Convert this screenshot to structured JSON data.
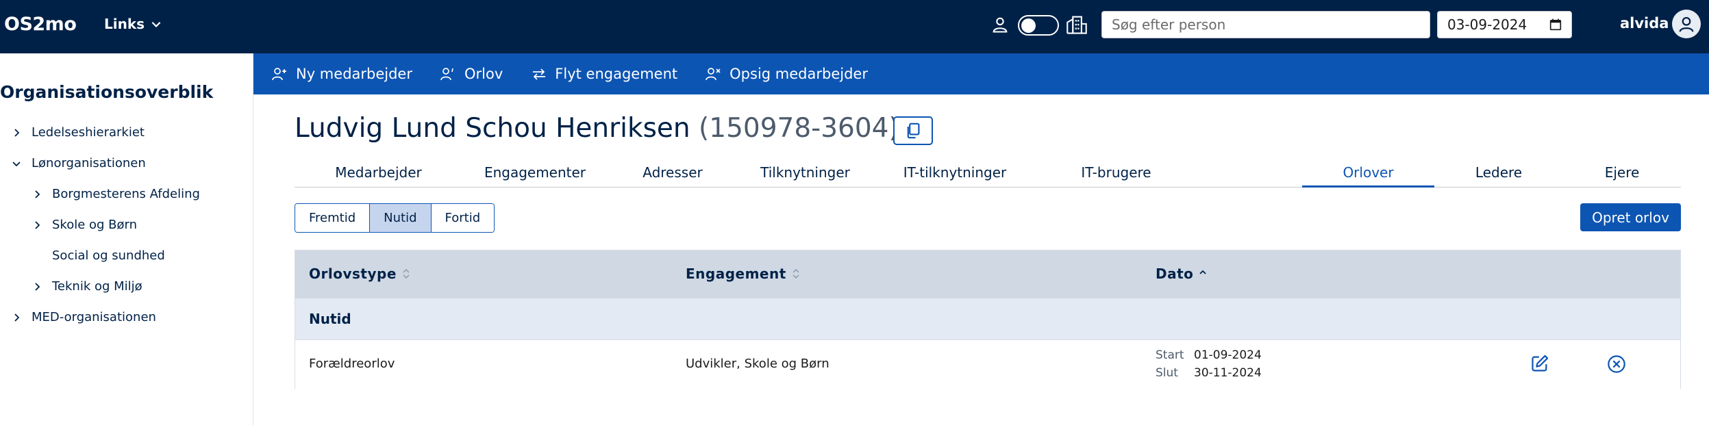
{
  "app": {
    "name": "OS2mo"
  },
  "topbar": {
    "links_label": "Links",
    "search_placeholder": "Søg efter person",
    "date_value": "03-09-2024",
    "username": "alvida"
  },
  "sidebar": {
    "title": "Organisationsoverblik",
    "items": [
      {
        "label": "Ledelseshierarkiet",
        "expanded": false
      },
      {
        "label": "Lønorganisationen",
        "expanded": true
      },
      {
        "label": "Borgmesterens Afdeling",
        "expanded": false
      },
      {
        "label": "Skole og Børn",
        "expanded": false
      },
      {
        "label": "Social og sundhed",
        "expanded": false
      },
      {
        "label": "Teknik og Miljø",
        "expanded": false
      },
      {
        "label": "MED-organisationen",
        "expanded": false
      }
    ]
  },
  "actions": [
    {
      "label": "Ny medarbejder",
      "icon": "user-plus-icon"
    },
    {
      "label": "Orlov",
      "icon": "user-leave-icon"
    },
    {
      "label": "Flyt engagement",
      "icon": "swap-arrows-icon"
    },
    {
      "label": "Opsig medarbejder",
      "icon": "user-remove-icon"
    }
  ],
  "employee": {
    "name": "Ludvig Lund Schou Henriksen",
    "cpr": "(150978-3604)"
  },
  "tabs": [
    {
      "label": "Medarbejder",
      "active": false
    },
    {
      "label": "Engagementer",
      "active": false
    },
    {
      "label": "Adresser",
      "active": false
    },
    {
      "label": "Tilknytninger",
      "active": false
    },
    {
      "label": "IT-tilknytninger",
      "active": false
    },
    {
      "label": "IT-brugere",
      "active": false
    },
    {
      "label": "Orlover",
      "active": true
    },
    {
      "label": "Ledere",
      "active": false
    },
    {
      "label": "Ejere",
      "active": false
    }
  ],
  "time_filter": {
    "options": [
      "Fremtid",
      "Nutid",
      "Fortid"
    ],
    "selected": "Nutid"
  },
  "create_button": "Opret orlov",
  "table": {
    "columns": [
      "Orlovstype",
      "Engagement",
      "Dato"
    ],
    "group_label": "Nutid",
    "rows": [
      {
        "orlovstype": "Forældreorlov",
        "engagement": "Udvikler, Skole og Børn",
        "start_label": "Start",
        "start": "01-09-2024",
        "end_label": "Slut",
        "end": "30-11-2024"
      }
    ]
  },
  "colors": {
    "topbar": "#002147",
    "actionbar": "#0d55b3",
    "accent": "#0d55b3",
    "table_header": "#cfd8e3",
    "group_row": "#e3eaf3"
  }
}
